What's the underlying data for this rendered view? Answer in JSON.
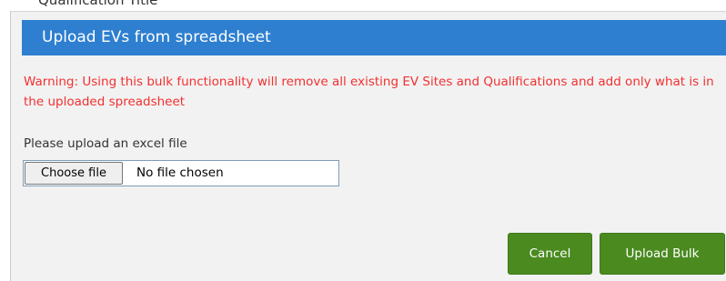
{
  "background": {
    "partial_text": "Qualification Title"
  },
  "modal": {
    "title": "Upload EVs from spreadsheet",
    "warning": "Warning: Using this bulk functionality will remove all existing EV Sites and Qualifications and add only what is in the uploaded spreadsheet",
    "upload_label": "Please upload an excel file",
    "file_input": {
      "button_label": "Choose file",
      "status": "No file chosen"
    },
    "buttons": {
      "cancel": "Cancel",
      "upload": "Upload Bulk"
    }
  },
  "colors": {
    "header": "#2e7fd0",
    "warning": "#f23030",
    "button": "#4a8a1f",
    "modal_background": "#f2f2f2"
  }
}
